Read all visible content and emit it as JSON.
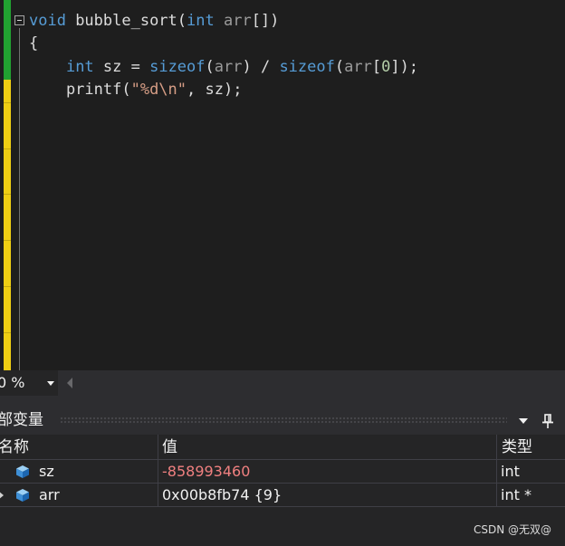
{
  "editor": {
    "lines": [
      {
        "parts": [
          {
            "cls": "kw",
            "t": "void"
          },
          {
            "cls": "",
            "t": " bubble_sort("
          },
          {
            "cls": "kw",
            "t": "int"
          },
          {
            "cls": "dim",
            "t": " arr"
          },
          {
            "cls": "",
            "t": "[])"
          }
        ]
      },
      {
        "parts": [
          {
            "cls": "",
            "t": "{"
          }
        ]
      },
      {
        "parts": [
          {
            "cls": "",
            "t": "    "
          },
          {
            "cls": "kw",
            "t": "int"
          },
          {
            "cls": "",
            "t": " sz = "
          },
          {
            "cls": "kw",
            "t": "sizeof"
          },
          {
            "cls": "",
            "t": "("
          },
          {
            "cls": "dim",
            "t": "arr"
          },
          {
            "cls": "",
            "t": ") / "
          },
          {
            "cls": "kw",
            "t": "sizeof"
          },
          {
            "cls": "",
            "t": "("
          },
          {
            "cls": "dim",
            "t": "arr"
          },
          {
            "cls": "",
            "t": "["
          },
          {
            "cls": "num",
            "t": "0"
          },
          {
            "cls": "",
            "t": "]);"
          }
        ]
      },
      {
        "parts": [
          {
            "cls": "",
            "t": "    printf("
          },
          {
            "cls": "str",
            "t": "\"%d\\n\""
          },
          {
            "cls": "",
            "t": ", sz);"
          }
        ]
      }
    ]
  },
  "status": {
    "zoom": "0 %"
  },
  "locals": {
    "title": "部变量",
    "columns": {
      "name": "名称",
      "value": "值",
      "type": "类型"
    },
    "rows": [
      {
        "name": "sz",
        "value": "-858993460",
        "type": "int",
        "changed": true,
        "expandable": false
      },
      {
        "name": "arr",
        "value": "0x00b8fb74 {9}",
        "type": "int *",
        "changed": false,
        "expandable": true
      }
    ]
  },
  "watermark": "CSDN @无双@",
  "colors": {
    "keyword": "#569cd6",
    "string": "#d69d85",
    "changed_value": "#f08080",
    "bar_green": "#21a131",
    "bar_yellow": "#efce13"
  },
  "icons": {
    "variable": "variable-cube-icon",
    "pin": "pin-icon",
    "dropdown": "chevron-down-icon",
    "expand": "expand-arrow-icon"
  }
}
